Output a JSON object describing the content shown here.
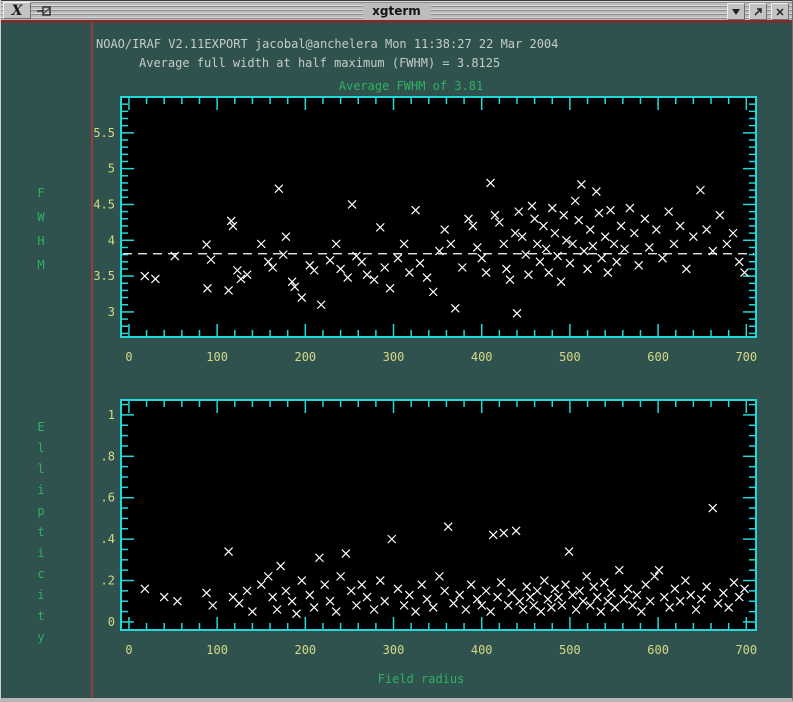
{
  "window": {
    "title": "xgterm"
  },
  "titlebar": {
    "menu_icon": "x11-logo",
    "buttons": [
      {
        "name": "iconify",
        "icon": "triangle-down-icon"
      },
      {
        "name": "maximize",
        "icon": "resize-arrow-icon"
      },
      {
        "name": "close",
        "icon": "close-x-icon"
      }
    ]
  },
  "terminal": {
    "banner": "NOAO/IRAF V2.11EXPORT jacobal@anchelera Mon 11:38:27 22 Mar 2004",
    "fwhm_line": "Average full width at half maximum (FWHM) = 3.8125"
  },
  "chart_data": [
    {
      "type": "scatter",
      "title": "Average FWHM of 3.81",
      "ylabel": "FWHM",
      "xlabel": "",
      "marker": "x",
      "legend": "none",
      "grid": false,
      "xlim": [
        -9,
        711
      ],
      "ylim": [
        2.65,
        6.0
      ],
      "xticks": {
        "values": [
          0,
          100,
          200,
          300,
          400,
          500,
          600,
          700
        ],
        "labels": [
          "0",
          "100",
          "200",
          "300",
          "400",
          "500",
          "600",
          "700"
        ]
      },
      "yticks": {
        "values": [
          3,
          3.5,
          4,
          4.5,
          5,
          5.5
        ],
        "labels": [
          "3",
          "3.5",
          "4",
          "4.5",
          "5",
          "5.5"
        ]
      },
      "x_minor_step": 20,
      "y_minor_step": 0.1,
      "average_line": 3.8125,
      "points": [
        [
          18,
          3.5
        ],
        [
          30,
          3.46
        ],
        [
          52,
          3.78
        ],
        [
          88,
          3.94
        ],
        [
          89,
          3.33
        ],
        [
          93,
          3.73
        ],
        [
          113,
          3.3
        ],
        [
          116,
          4.27
        ],
        [
          118,
          4.2
        ],
        [
          123,
          3.58
        ],
        [
          127,
          3.46
        ],
        [
          134,
          3.52
        ],
        [
          150,
          3.95
        ],
        [
          158,
          3.7
        ],
        [
          163,
          3.62
        ],
        [
          170,
          4.72
        ],
        [
          175,
          3.8
        ],
        [
          178,
          4.05
        ],
        [
          185,
          3.42
        ],
        [
          188,
          3.35
        ],
        [
          196,
          3.2
        ],
        [
          205,
          3.65
        ],
        [
          210,
          3.58
        ],
        [
          218,
          3.1
        ],
        [
          228,
          3.72
        ],
        [
          235,
          3.95
        ],
        [
          240,
          3.6
        ],
        [
          248,
          3.48
        ],
        [
          253,
          4.5
        ],
        [
          258,
          3.78
        ],
        [
          264,
          3.7
        ],
        [
          270,
          3.52
        ],
        [
          278,
          3.45
        ],
        [
          285,
          4.18
        ],
        [
          290,
          3.62
        ],
        [
          296,
          3.33
        ],
        [
          305,
          3.75
        ],
        [
          312,
          3.95
        ],
        [
          318,
          3.55
        ],
        [
          325,
          4.42
        ],
        [
          330,
          3.68
        ],
        [
          338,
          3.48
        ],
        [
          345,
          3.28
        ],
        [
          352,
          3.85
        ],
        [
          358,
          4.15
        ],
        [
          365,
          3.95
        ],
        [
          370,
          3.05
        ],
        [
          378,
          3.62
        ],
        [
          385,
          4.3
        ],
        [
          390,
          4.2
        ],
        [
          395,
          3.9
        ],
        [
          400,
          3.75
        ],
        [
          405,
          3.55
        ],
        [
          410,
          4.8
        ],
        [
          415,
          4.35
        ],
        [
          420,
          4.25
        ],
        [
          425,
          3.95
        ],
        [
          428,
          3.6
        ],
        [
          432,
          3.45
        ],
        [
          438,
          4.1
        ],
        [
          440,
          2.98
        ],
        [
          442,
          4.4
        ],
        [
          446,
          4.05
        ],
        [
          450,
          3.8
        ],
        [
          453,
          3.52
        ],
        [
          457,
          4.48
        ],
        [
          460,
          4.3
        ],
        [
          463,
          3.95
        ],
        [
          466,
          3.7
        ],
        [
          470,
          4.2
        ],
        [
          473,
          3.88
        ],
        [
          476,
          3.55
        ],
        [
          480,
          4.45
        ],
        [
          483,
          4.1
        ],
        [
          486,
          3.78
        ],
        [
          490,
          3.42
        ],
        [
          493,
          4.35
        ],
        [
          496,
          4.0
        ],
        [
          500,
          3.68
        ],
        [
          503,
          3.95
        ],
        [
          506,
          4.55
        ],
        [
          510,
          4.28
        ],
        [
          513,
          4.78
        ],
        [
          516,
          3.85
        ],
        [
          520,
          3.6
        ],
        [
          523,
          4.15
        ],
        [
          526,
          3.92
        ],
        [
          530,
          4.68
        ],
        [
          533,
          4.38
        ],
        [
          536,
          3.75
        ],
        [
          540,
          4.05
        ],
        [
          543,
          3.55
        ],
        [
          546,
          4.42
        ],
        [
          550,
          3.95
        ],
        [
          553,
          3.7
        ],
        [
          558,
          4.2
        ],
        [
          562,
          3.88
        ],
        [
          568,
          4.45
        ],
        [
          573,
          4.1
        ],
        [
          578,
          3.65
        ],
        [
          585,
          4.3
        ],
        [
          590,
          3.9
        ],
        [
          598,
          4.15
        ],
        [
          605,
          3.75
        ],
        [
          612,
          4.4
        ],
        [
          618,
          3.95
        ],
        [
          625,
          4.2
        ],
        [
          632,
          3.6
        ],
        [
          640,
          4.05
        ],
        [
          648,
          4.7
        ],
        [
          655,
          4.15
        ],
        [
          662,
          3.85
        ],
        [
          670,
          4.35
        ],
        [
          678,
          3.95
        ],
        [
          685,
          4.1
        ],
        [
          692,
          3.7
        ],
        [
          698,
          3.55
        ]
      ]
    },
    {
      "type": "scatter",
      "title": "",
      "ylabel": "Ellipticity",
      "xlabel": "Field radius",
      "marker": "x",
      "legend": "none",
      "grid": false,
      "xlim": [
        -9,
        711
      ],
      "ylim": [
        -0.039,
        1.072
      ],
      "xticks": {
        "values": [
          0,
          100,
          200,
          300,
          400,
          500,
          600,
          700
        ],
        "labels": [
          "0",
          "100",
          "200",
          "300",
          "400",
          "500",
          "600",
          "700"
        ]
      },
      "yticks": {
        "values": [
          0,
          0.2,
          0.4,
          0.6,
          0.8,
          1
        ],
        "labels": [
          "0",
          ".2",
          ".4",
          ".6",
          ".8",
          "1"
        ]
      },
      "x_minor_step": 20,
      "y_minor_step": 0.05,
      "average_line": null,
      "points": [
        [
          18,
          0.16
        ],
        [
          40,
          0.12
        ],
        [
          55,
          0.1
        ],
        [
          88,
          0.14
        ],
        [
          95,
          0.08
        ],
        [
          113,
          0.34
        ],
        [
          118,
          0.12
        ],
        [
          125,
          0.09
        ],
        [
          134,
          0.15
        ],
        [
          140,
          0.05
        ],
        [
          150,
          0.18
        ],
        [
          158,
          0.22
        ],
        [
          163,
          0.12
        ],
        [
          168,
          0.06
        ],
        [
          172,
          0.27
        ],
        [
          178,
          0.15
        ],
        [
          185,
          0.1
        ],
        [
          190,
          0.04
        ],
        [
          196,
          0.2
        ],
        [
          205,
          0.13
        ],
        [
          210,
          0.07
        ],
        [
          216,
          0.31
        ],
        [
          222,
          0.18
        ],
        [
          228,
          0.1
        ],
        [
          235,
          0.05
        ],
        [
          240,
          0.22
        ],
        [
          246,
          0.33
        ],
        [
          252,
          0.15
        ],
        [
          258,
          0.08
        ],
        [
          264,
          0.18
        ],
        [
          270,
          0.12
        ],
        [
          278,
          0.06
        ],
        [
          285,
          0.2
        ],
        [
          290,
          0.1
        ],
        [
          298,
          0.4
        ],
        [
          305,
          0.16
        ],
        [
          312,
          0.08
        ],
        [
          318,
          0.13
        ],
        [
          325,
          0.05
        ],
        [
          332,
          0.18
        ],
        [
          338,
          0.11
        ],
        [
          345,
          0.07
        ],
        [
          352,
          0.22
        ],
        [
          358,
          0.15
        ],
        [
          362,
          0.46
        ],
        [
          368,
          0.09
        ],
        [
          375,
          0.13
        ],
        [
          382,
          0.06
        ],
        [
          388,
          0.18
        ],
        [
          395,
          0.11
        ],
        [
          400,
          0.08
        ],
        [
          405,
          0.15
        ],
        [
          410,
          0.05
        ],
        [
          413,
          0.42
        ],
        [
          418,
          0.12
        ],
        [
          422,
          0.19
        ],
        [
          425,
          0.43
        ],
        [
          430,
          0.08
        ],
        [
          434,
          0.14
        ],
        [
          439,
          0.44
        ],
        [
          443,
          0.1
        ],
        [
          447,
          0.06
        ],
        [
          451,
          0.17
        ],
        [
          455,
          0.12
        ],
        [
          459,
          0.08
        ],
        [
          463,
          0.15
        ],
        [
          467,
          0.05
        ],
        [
          471,
          0.2
        ],
        [
          475,
          0.11
        ],
        [
          479,
          0.07
        ],
        [
          483,
          0.16
        ],
        [
          487,
          0.12
        ],
        [
          491,
          0.08
        ],
        [
          495,
          0.18
        ],
        [
          499,
          0.34
        ],
        [
          503,
          0.13
        ],
        [
          507,
          0.06
        ],
        [
          511,
          0.15
        ],
        [
          515,
          0.1
        ],
        [
          519,
          0.22
        ],
        [
          523,
          0.08
        ],
        [
          527,
          0.17
        ],
        [
          531,
          0.12
        ],
        [
          535,
          0.05
        ],
        [
          539,
          0.19
        ],
        [
          543,
          0.1
        ],
        [
          547,
          0.14
        ],
        [
          551,
          0.07
        ],
        [
          556,
          0.25
        ],
        [
          561,
          0.11
        ],
        [
          566,
          0.16
        ],
        [
          571,
          0.08
        ],
        [
          576,
          0.13
        ],
        [
          581,
          0.05
        ],
        [
          586,
          0.18
        ],
        [
          591,
          0.1
        ],
        [
          596,
          0.22
        ],
        [
          601,
          0.25
        ],
        [
          607,
          0.12
        ],
        [
          613,
          0.07
        ],
        [
          619,
          0.16
        ],
        [
          625,
          0.1
        ],
        [
          631,
          0.2
        ],
        [
          637,
          0.13
        ],
        [
          643,
          0.06
        ],
        [
          649,
          0.11
        ],
        [
          655,
          0.17
        ],
        [
          662,
          0.55
        ],
        [
          668,
          0.09
        ],
        [
          674,
          0.14
        ],
        [
          680,
          0.07
        ],
        [
          686,
          0.19
        ],
        [
          692,
          0.12
        ],
        [
          698,
          0.16
        ]
      ]
    }
  ],
  "colors": {
    "window_bg": "#2f524e",
    "titlebar": "#b9b9b9",
    "maroon_line": "#7b2e2e",
    "cursor_line": "#9a3c3c",
    "text": "#c6ccc6",
    "green": "#2fb261",
    "tick_label": "#d6da86",
    "cyan": "#22d8d8",
    "plot_bg": "#000000",
    "points": "#ffffff"
  }
}
